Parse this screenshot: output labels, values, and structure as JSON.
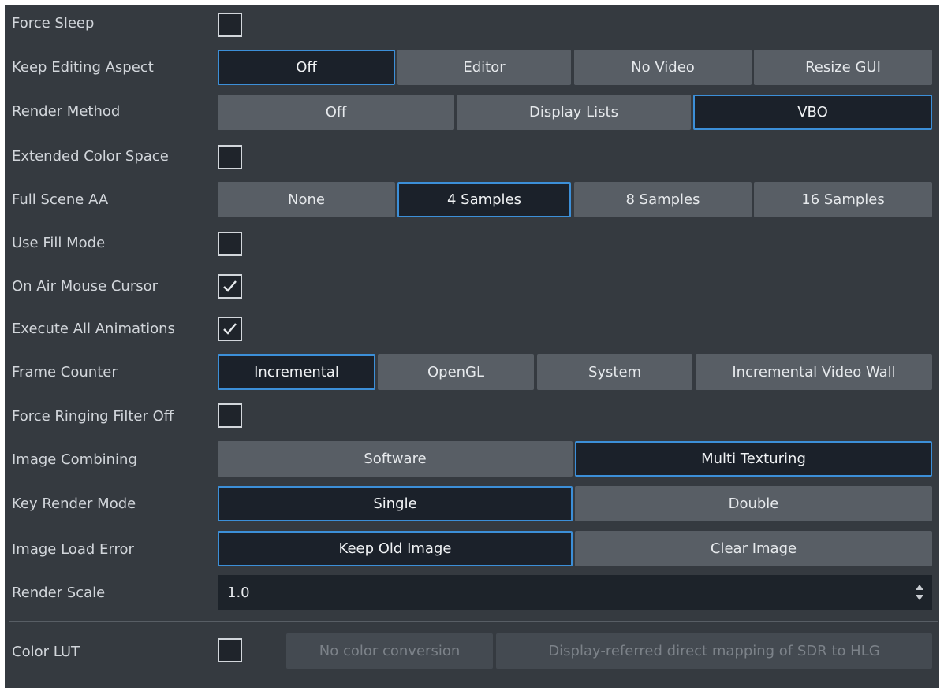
{
  "rows": [
    {
      "label": "Force Sleep"
    },
    {
      "label": "Keep Editing Aspect",
      "options": [
        "Off",
        "Editor",
        "No Video",
        "Resize GUI"
      ],
      "selected": "Off"
    },
    {
      "label": "Render Method",
      "options": [
        "Off",
        "Display Lists",
        "VBO"
      ],
      "selected": "VBO"
    },
    {
      "label": "Extended Color Space"
    },
    {
      "label": "Full Scene AA",
      "options": [
        "None",
        "4 Samples",
        "8 Samples",
        "16 Samples"
      ],
      "selected": "4 Samples"
    },
    {
      "label": "Use Fill Mode"
    },
    {
      "label": "On Air Mouse Cursor"
    },
    {
      "label": "Execute All Animations"
    },
    {
      "label": "Frame Counter",
      "options": [
        "Incremental",
        "OpenGL",
        "System",
        "Incremental Video Wall"
      ],
      "selected": "Incremental"
    },
    {
      "label": "Force Ringing Filter Off"
    },
    {
      "label": "Image Combining",
      "options": [
        "Software",
        "Multi Texturing"
      ],
      "selected": "Multi Texturing"
    },
    {
      "label": "Key Render Mode",
      "options": [
        "Single",
        "Double"
      ],
      "selected": "Single"
    },
    {
      "label": "Image Load Error",
      "options": [
        "Keep Old Image",
        "Clear Image"
      ],
      "selected": "Keep Old Image"
    },
    {
      "label": "Render Scale",
      "value": "1.0"
    },
    {
      "label": "Color LUT",
      "options": [
        "No color conversion",
        "Display-referred direct mapping of SDR to HLG"
      ]
    }
  ],
  "checkboxes": {
    "force_sleep": false,
    "extended_color_space": false,
    "use_fill_mode": false,
    "on_air_mouse_cursor": true,
    "execute_all_animations": true,
    "force_ringing_filter_off": false,
    "color_lut": false
  },
  "colors": {
    "panel_bg": "#353a40",
    "button_bg": "#585e65",
    "selected_bg": "#1b212a",
    "selected_border": "#3c8fd8",
    "disabled_text": "#7c8289"
  },
  "icons": {
    "checkmark": "check-icon",
    "spinner": "spinner-arrows-icon"
  }
}
